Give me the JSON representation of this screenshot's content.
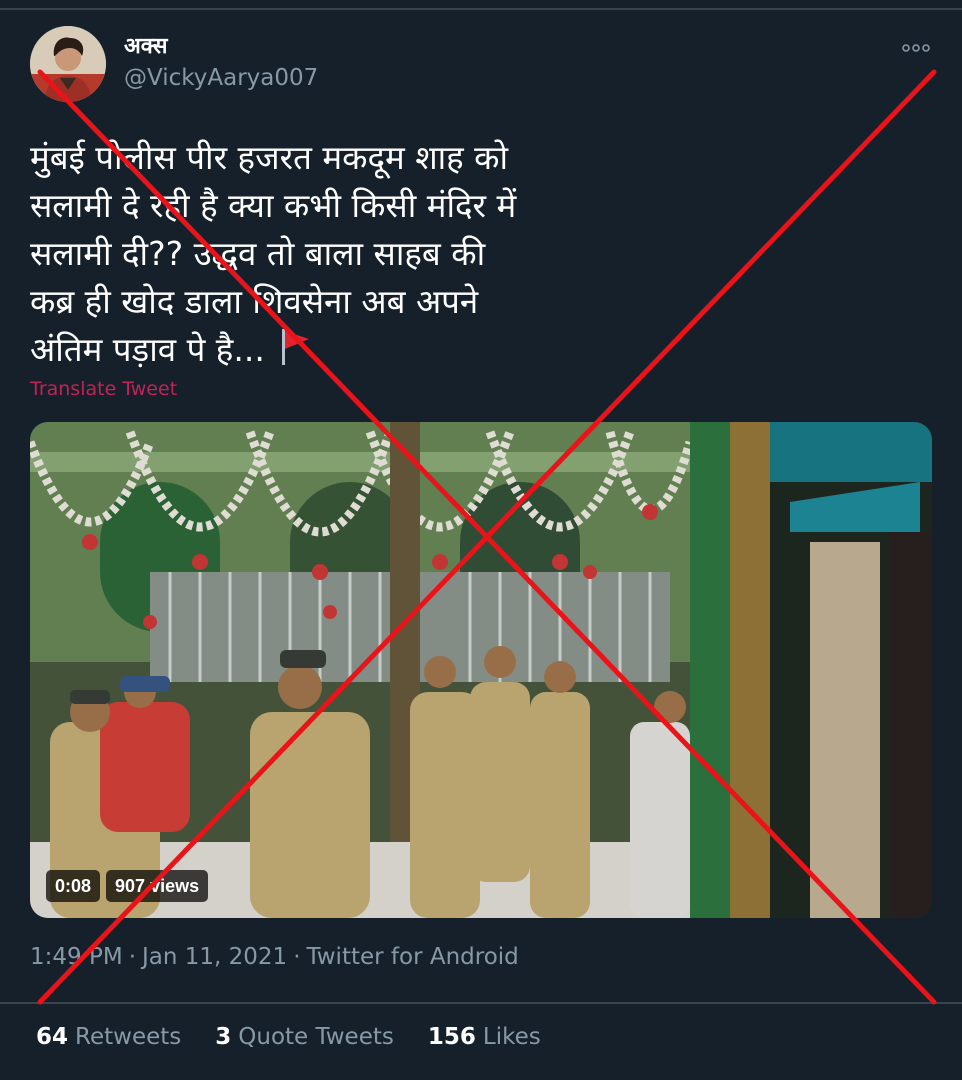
{
  "user": {
    "display_name": "अक्स",
    "handle": "@VickyAarya007"
  },
  "tweet": {
    "text_lines": [
      "मुंबई पोलीस पीर हजरत मकदूम शाह को",
      "सलामी दे रही है क्या कभी किसी मंदिर में",
      "सलामी दी?? उद्धव तो बाला साहब की",
      "कब्र ही खोद डाला शिवसेना अब अपने",
      "अंतिम पड़ाव पे है..."
    ],
    "translate_label": "Translate Tweet"
  },
  "video": {
    "duration": "0:08",
    "views": "907 views"
  },
  "meta": {
    "time": "1:49 PM",
    "date": "Jan 11, 2021",
    "source": "Twitter for Android",
    "separator": "·"
  },
  "stats": {
    "retweets_count": "64",
    "retweets_label": "Retweets",
    "quote_count": "3",
    "quote_label": "Quote Tweets",
    "likes_count": "156",
    "likes_label": "Likes"
  },
  "icons": {
    "more": "more-horizontal-icon",
    "flag": "red-flag-icon"
  },
  "colors": {
    "background": "#15202b",
    "secondary_text": "#8899a6",
    "translate": "#e0245e",
    "cross_mark": "#e8141a"
  }
}
